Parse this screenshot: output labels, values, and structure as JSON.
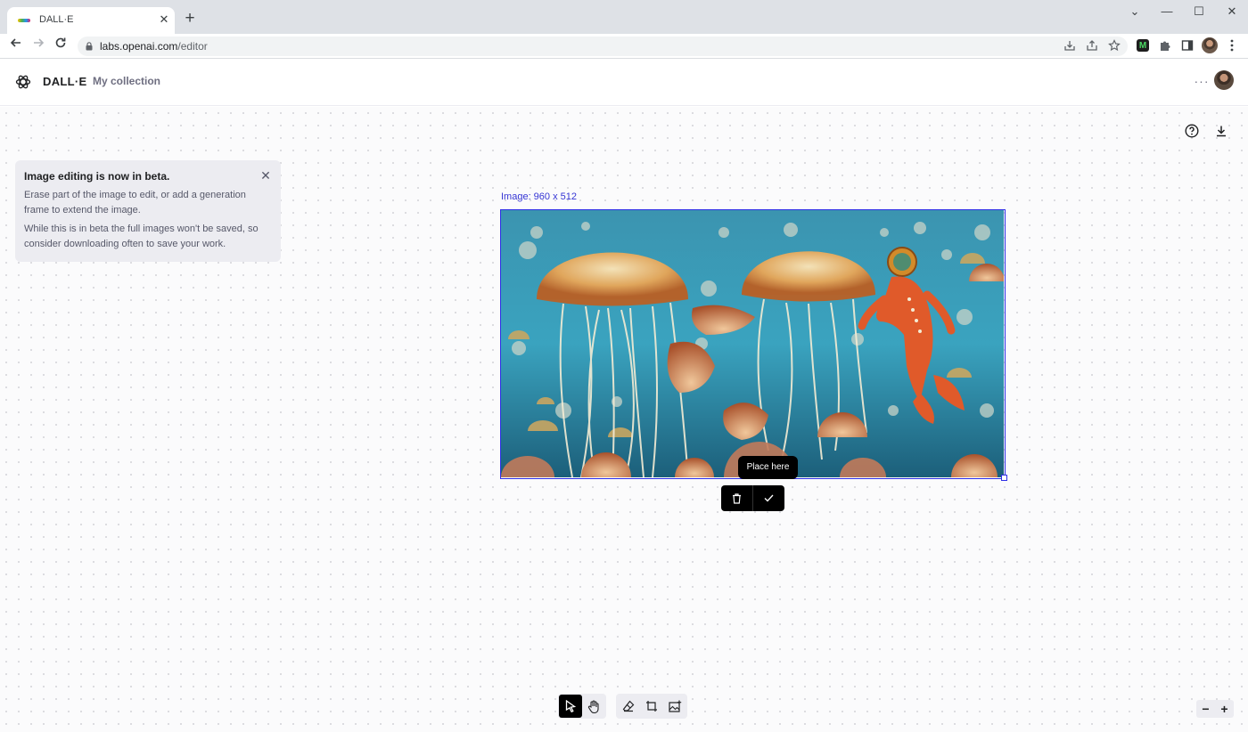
{
  "browser": {
    "tab_title": "DALL·E",
    "url_host": "labs.openai.com",
    "url_path": "/editor",
    "extension_label": "M"
  },
  "app": {
    "brand": "DALL·E",
    "nav_collection": "My collection",
    "more_label": "···"
  },
  "notice": {
    "title": "Image editing is now in beta.",
    "paragraph1": "Erase part of the image to edit, or add a generation frame to extend the image.",
    "paragraph2": "While this is in beta the full images won't be saved, so consider downloading often to save your work."
  },
  "canvas": {
    "image_label": "Image: 960 x 512",
    "tooltip": "Place here",
    "selected_tool": "select"
  },
  "colors": {
    "accent": "#2e2ee6",
    "canvas_bg": "#fbfbfc",
    "panel_bg": "#ececf1"
  },
  "icons": [
    "search-icon",
    "back-icon",
    "forward-icon",
    "reload-icon",
    "lock-icon",
    "install-icon",
    "share-icon",
    "star-icon",
    "puzzle-icon",
    "sidepanel-icon",
    "openai-logo",
    "help-icon",
    "download-icon",
    "close-icon",
    "trash-icon",
    "check-icon",
    "cursor-icon",
    "hand-icon",
    "eraser-icon",
    "frame-icon",
    "upload-image-icon",
    "zoom-out-icon",
    "zoom-in-icon"
  ]
}
